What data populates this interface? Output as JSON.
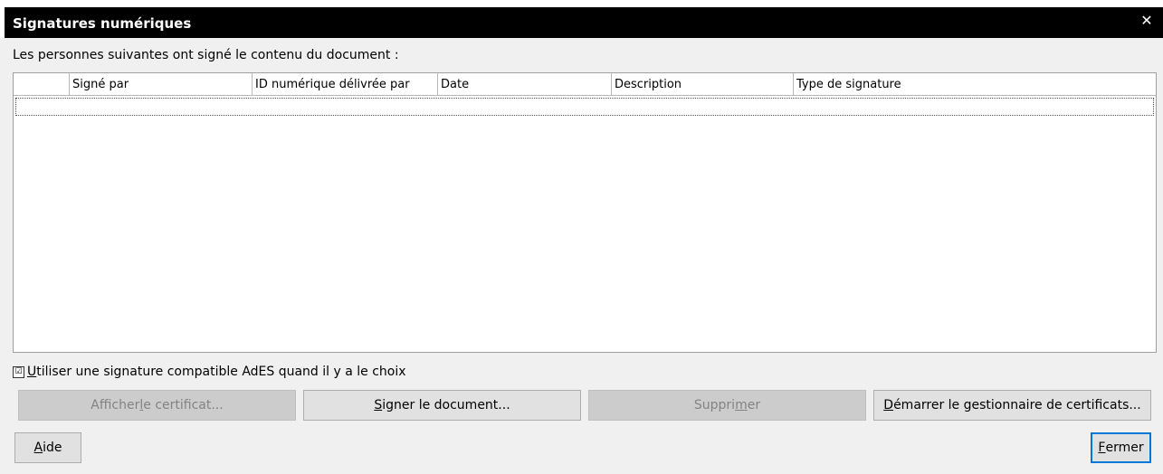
{
  "window": {
    "title": "Signatures numériques",
    "close_glyph": "✕"
  },
  "intro_text": "Les personnes suivantes ont signé le contenu du document :",
  "table": {
    "columns": [
      "",
      "Signé par",
      "ID numérique délivrée par",
      "Date",
      "Description",
      "Type de signature"
    ],
    "rows": []
  },
  "checkbox": {
    "checked": true,
    "glyph": "☑",
    "label_prefix": "",
    "label_mnemonic": "U",
    "label_rest": "tiliser une signature compatible AdES quand il y a le choix"
  },
  "buttons": {
    "view_cert": {
      "pre": "Afficher ",
      "mn": "l",
      "post": "e certificat...",
      "enabled": false
    },
    "sign": {
      "pre": "",
      "mn": "S",
      "post": "igner le document...",
      "enabled": true
    },
    "remove": {
      "pre": "Suppri",
      "mn": "m",
      "post": "er",
      "enabled": false
    },
    "cert_manager": {
      "pre": "",
      "mn": "D",
      "post": "émarrer le gestionnaire de certificats...",
      "enabled": true
    },
    "help": {
      "pre": "",
      "mn": "A",
      "post": "ide",
      "enabled": true
    },
    "close": {
      "pre": "",
      "mn": "F",
      "post": "ermer",
      "enabled": true
    }
  }
}
